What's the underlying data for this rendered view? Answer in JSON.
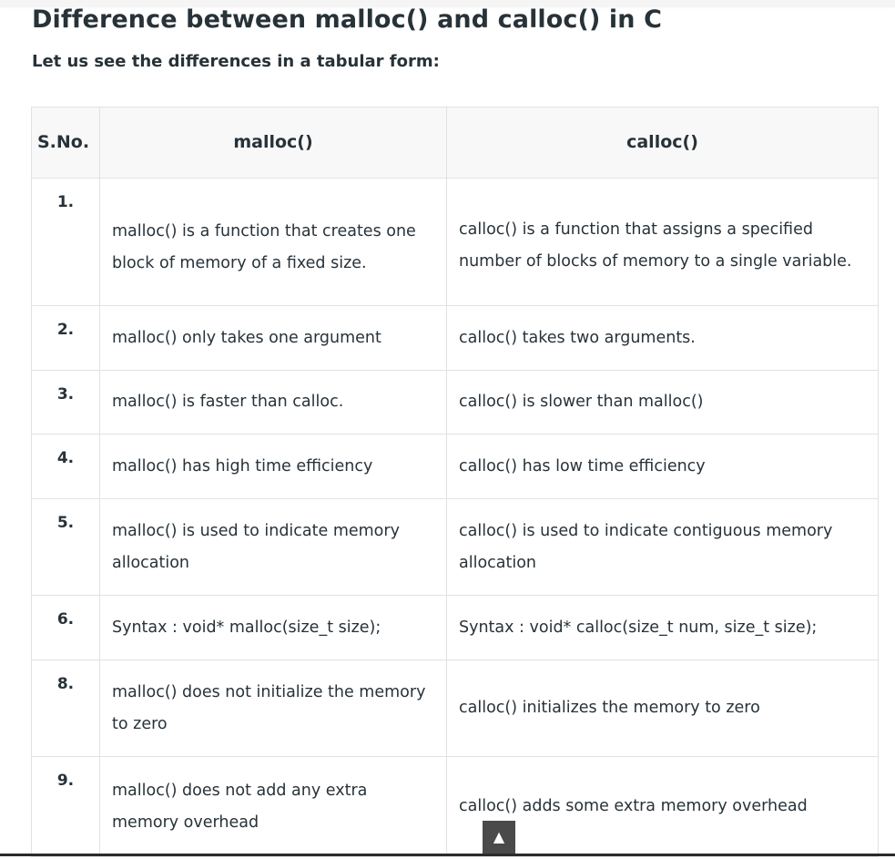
{
  "article": {
    "title": "Difference between malloc() and calloc() in C",
    "intro": "Let us see the differences in a tabular form:"
  },
  "table": {
    "headers": [
      "S.No.",
      "malloc()",
      "calloc()"
    ],
    "rows": [
      {
        "num": "1.",
        "malloc": "malloc() is a function that creates one block of memory of a fixed size.",
        "calloc": "calloc() is a function that assigns a specified number of blocks of memory to a single variable."
      },
      {
        "num": "2.",
        "malloc": "malloc() only takes one argument",
        "calloc": "calloc() takes two arguments."
      },
      {
        "num": "3.",
        "malloc": "malloc() is faster than calloc.",
        "calloc": "calloc() is slower than malloc()"
      },
      {
        "num": "4.",
        "malloc": "malloc() has high time efficiency",
        "calloc": "calloc() has low time efficiency"
      },
      {
        "num": "5.",
        "malloc": "malloc() is used to indicate memory allocation",
        "calloc": "calloc() is used to indicate contiguous memory allocation"
      },
      {
        "num": "6.",
        "malloc": "Syntax : void* malloc(size_t size);",
        "calloc": "Syntax : void* calloc(size_t num, size_t size);"
      },
      {
        "num": "8.",
        "malloc": "malloc() does not initialize the memory to zero",
        "calloc": "calloc() initializes the memory to zero"
      },
      {
        "num": "9.",
        "malloc": "malloc() does not add any extra memory overhead",
        "calloc": "calloc() adds some extra memory overhead"
      }
    ]
  },
  "scroll_top": {
    "glyph": "▲",
    "icon": "arrow-up-icon"
  }
}
